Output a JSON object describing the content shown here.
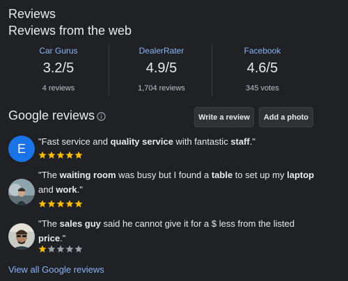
{
  "header": {
    "title": "Reviews",
    "subtitle": "Reviews from the web"
  },
  "web_sources": [
    {
      "name": "Car Gurus",
      "score": "3.2/5",
      "count": "4 reviews"
    },
    {
      "name": "DealerRater",
      "score": "4.9/5",
      "count": "1,704 reviews"
    },
    {
      "name": "Facebook",
      "score": "4.6/5",
      "count": "345 votes"
    }
  ],
  "google_reviews": {
    "title": "Google reviews",
    "info_icon": "info-icon",
    "write_review_label": "Write a review",
    "add_photo_label": "Add a photo",
    "view_all_label": "View all Google reviews",
    "star_color": "#fbbc04",
    "star_empty_color": "#9aa0a6",
    "items": [
      {
        "avatar_letter": "E",
        "avatar_color": "#1a73e8",
        "segments": [
          {
            "t": "\"Fast service and ",
            "b": false
          },
          {
            "t": "quality service",
            "b": true
          },
          {
            "t": " with fantastic ",
            "b": false
          },
          {
            "t": "staff",
            "b": true
          },
          {
            "t": ".\"",
            "b": false
          }
        ],
        "rating": 5
      },
      {
        "avatar_letter": "",
        "segments": [
          {
            "t": "\"The ",
            "b": false
          },
          {
            "t": "waiting room",
            "b": true
          },
          {
            "t": " was busy but I found a ",
            "b": false
          },
          {
            "t": "table",
            "b": true
          },
          {
            "t": " to set up my ",
            "b": false
          },
          {
            "t": "laptop",
            "b": true
          },
          {
            "t": " and ",
            "b": false
          },
          {
            "t": "work",
            "b": true
          },
          {
            "t": ".\"",
            "b": false
          }
        ],
        "rating": 5
      },
      {
        "avatar_letter": "",
        "segments": [
          {
            "t": "\"The ",
            "b": false
          },
          {
            "t": "sales guy",
            "b": true
          },
          {
            "t": " said he cannot give it for a $ less from the listed ",
            "b": false
          },
          {
            "t": "price",
            "b": true
          },
          {
            "t": ".\"",
            "b": false
          }
        ],
        "rating": 1
      }
    ]
  }
}
